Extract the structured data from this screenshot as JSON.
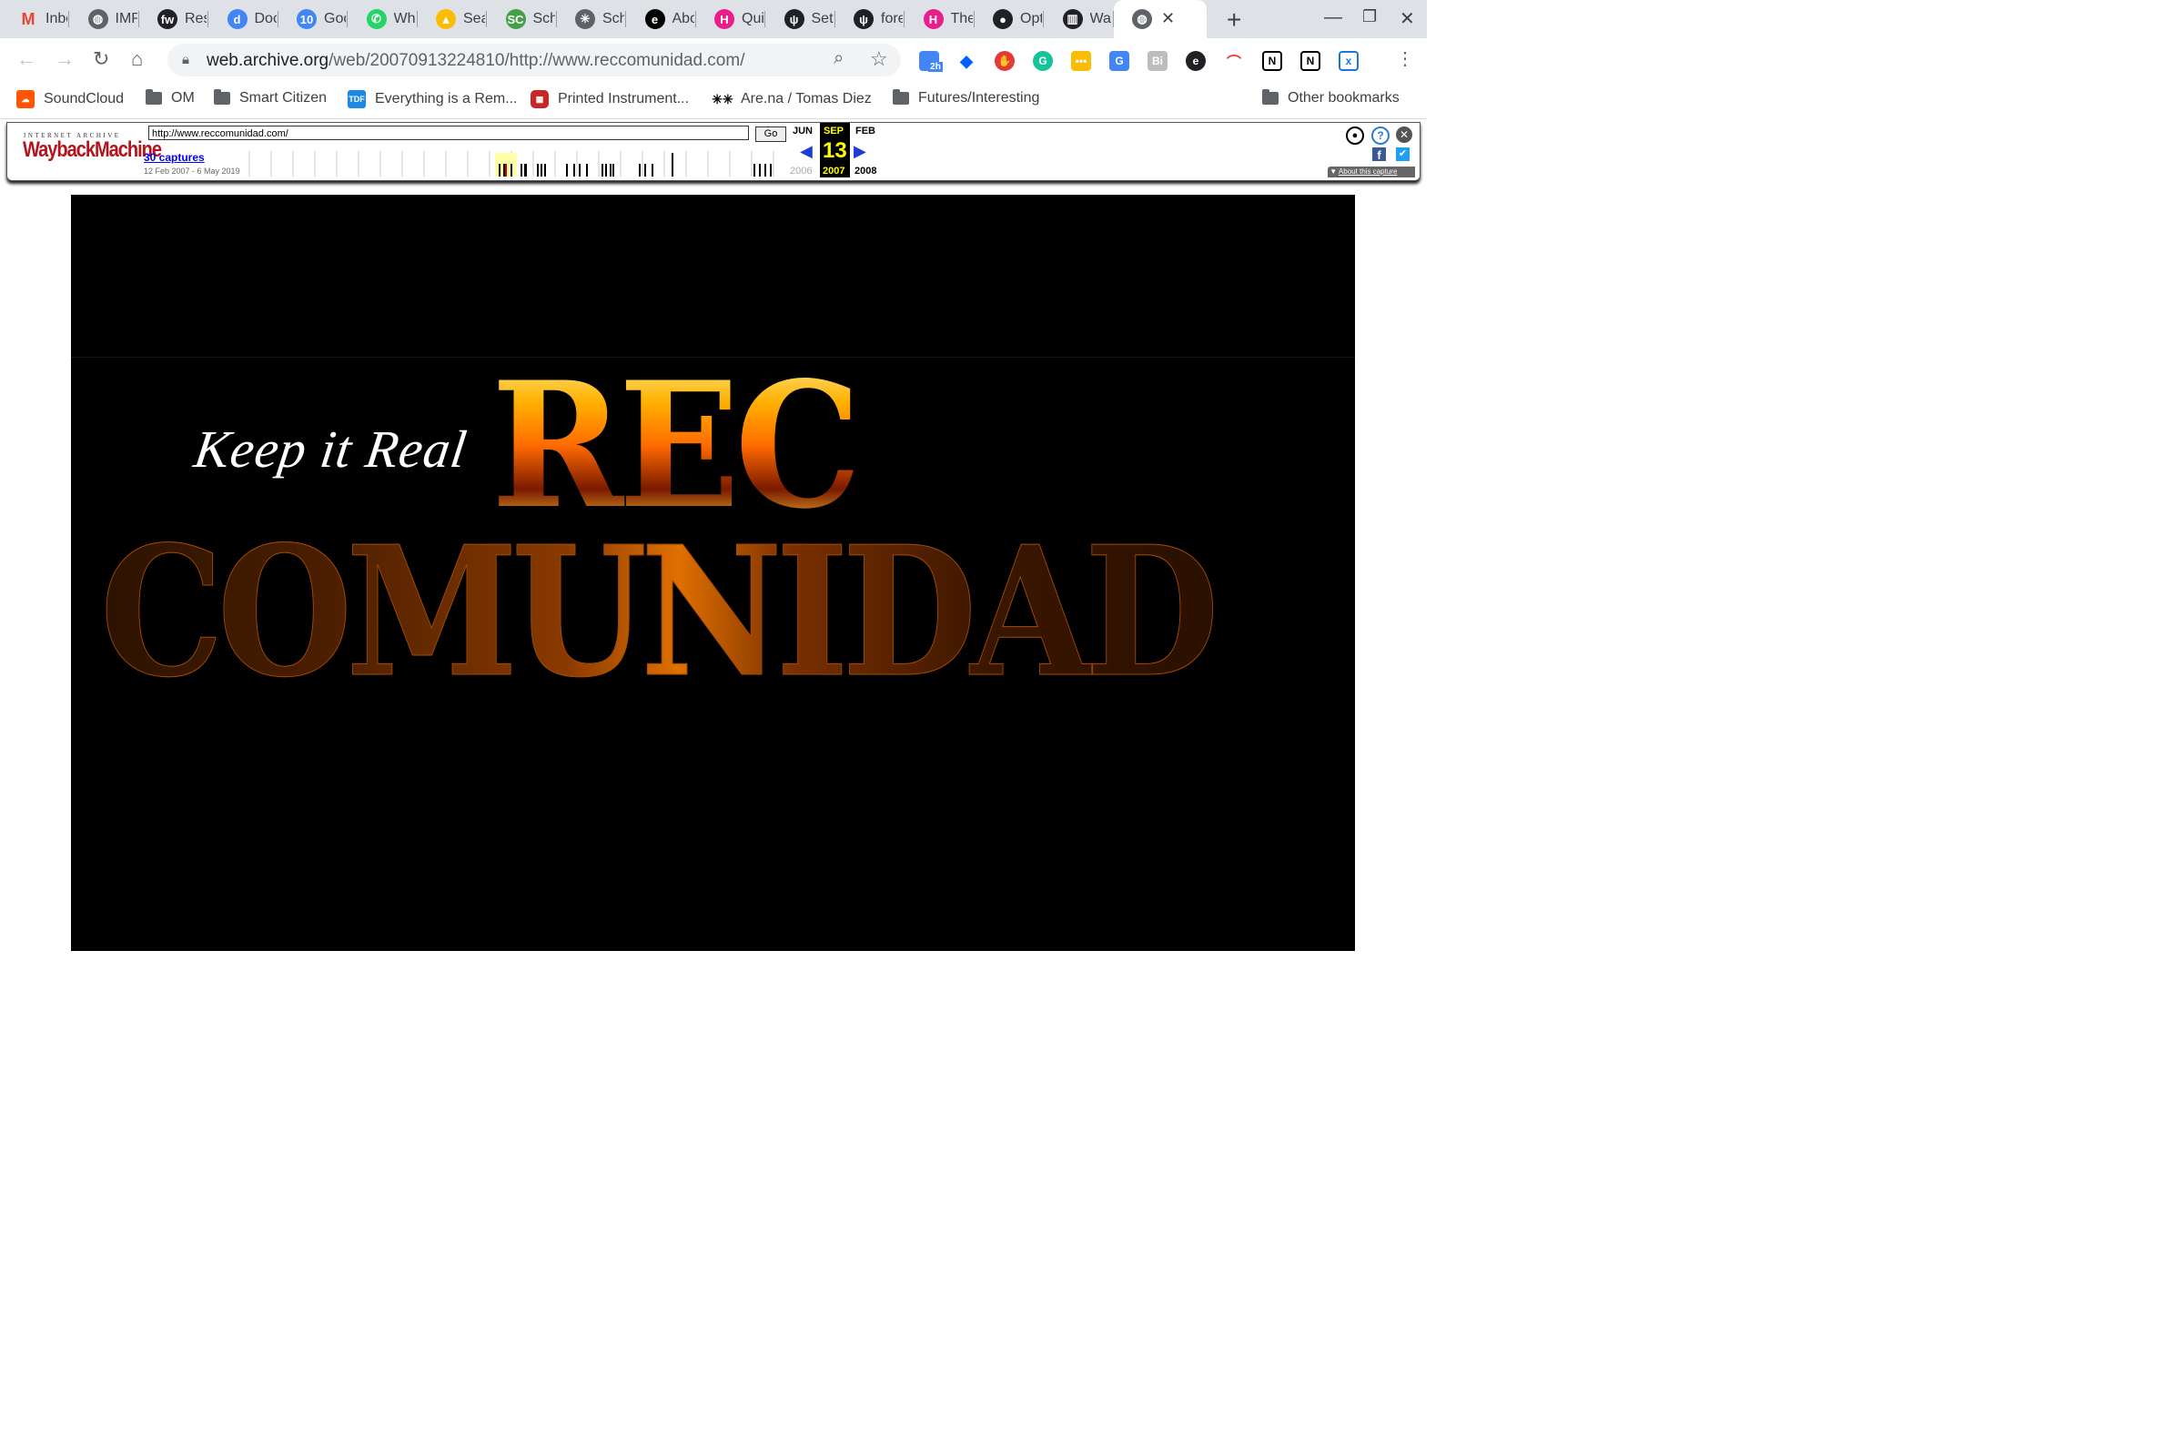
{
  "browser": {
    "tabs": [
      {
        "title": "Inbox",
        "icon": "gmail-icon",
        "color": "#ea4335",
        "glyph": "M"
      },
      {
        "title": "IMP",
        "icon": "globe-icon",
        "color": "#5f6368",
        "glyph": "◍"
      },
      {
        "title": "Res",
        "icon": "fw-icon",
        "color": "#202124",
        "glyph": "fw"
      },
      {
        "title": "Doc",
        "icon": "d-icon",
        "color": "#4285f4",
        "glyph": "d"
      },
      {
        "title": "Goo",
        "icon": "calendar-icon",
        "color": "#4285f4",
        "glyph": "10"
      },
      {
        "title": "Wha",
        "icon": "whatsapp-icon",
        "color": "#25d366",
        "glyph": "✆"
      },
      {
        "title": "Sea",
        "icon": "drive-icon",
        "color": "#fbbc04",
        "glyph": "▲"
      },
      {
        "title": "Sch",
        "icon": "sc-icon",
        "color": "#43a047",
        "glyph": "SC"
      },
      {
        "title": "Sch",
        "icon": "asterisk-icon",
        "color": "#5f6368",
        "glyph": "✳"
      },
      {
        "title": "Abo",
        "icon": "e-icon",
        "color": "#000000",
        "glyph": "e"
      },
      {
        "title": "Qui",
        "icon": "h-hexagon-icon",
        "color": "#e91e8c",
        "glyph": "H"
      },
      {
        "title": "Setu",
        "icon": "antenna-icon",
        "color": "#202124",
        "glyph": "ψ"
      },
      {
        "title": "fore",
        "icon": "antenna-icon",
        "color": "#202124",
        "glyph": "ψ"
      },
      {
        "title": "The",
        "icon": "h-hexagon-icon",
        "color": "#e91e8c",
        "glyph": "H"
      },
      {
        "title": "Opt",
        "icon": "github-icon",
        "color": "#202124",
        "glyph": "●"
      },
      {
        "title": "Wa",
        "icon": "archive-icon",
        "color": "#202124",
        "glyph": "▥"
      },
      {
        "title": "",
        "icon": "globe-icon",
        "color": "#5f6368",
        "glyph": "◍",
        "active": true
      }
    ],
    "new_tab_label": "+",
    "close_tab_label": "✕",
    "url_host": "web.archive.org",
    "url_path": "/web/20070913224810/http://www.reccomunidad.com/",
    "extension_badge": "2h",
    "bookmarks": [
      {
        "label": "SoundCloud",
        "type": "soundcloud"
      },
      {
        "label": "OM",
        "type": "folder"
      },
      {
        "label": "Smart Citizen",
        "type": "folder"
      },
      {
        "label": "Everything is a Rem...",
        "type": "tdf"
      },
      {
        "label": "Printed Instrument...",
        "type": "red"
      },
      {
        "label": "Are.na / Tomas Diez",
        "type": "arena"
      },
      {
        "label": "Futures/Interesting",
        "type": "folder"
      }
    ],
    "other_bookmarks": "Other bookmarks"
  },
  "wayback": {
    "logo_top": "INTERNET ARCHIVE",
    "logo": "WaybackMachine",
    "url_value": "http://www.reccomunidad.com/",
    "go_label": "Go",
    "captures": "30 captures",
    "range": "12 Feb 2007 - 6 May 2019",
    "prev_month": "JUN",
    "cur_month": "SEP",
    "next_month": "FEB",
    "day": "13",
    "prev_year": "2006",
    "cur_year": "2007",
    "next_year": "2008",
    "about": "About this capture",
    "accent": "#ffff00"
  },
  "site": {
    "tagline": "Keep it Real",
    "word1": "REC",
    "word2": "COMUNIDAD",
    "fire_color": "#ff8c00"
  }
}
